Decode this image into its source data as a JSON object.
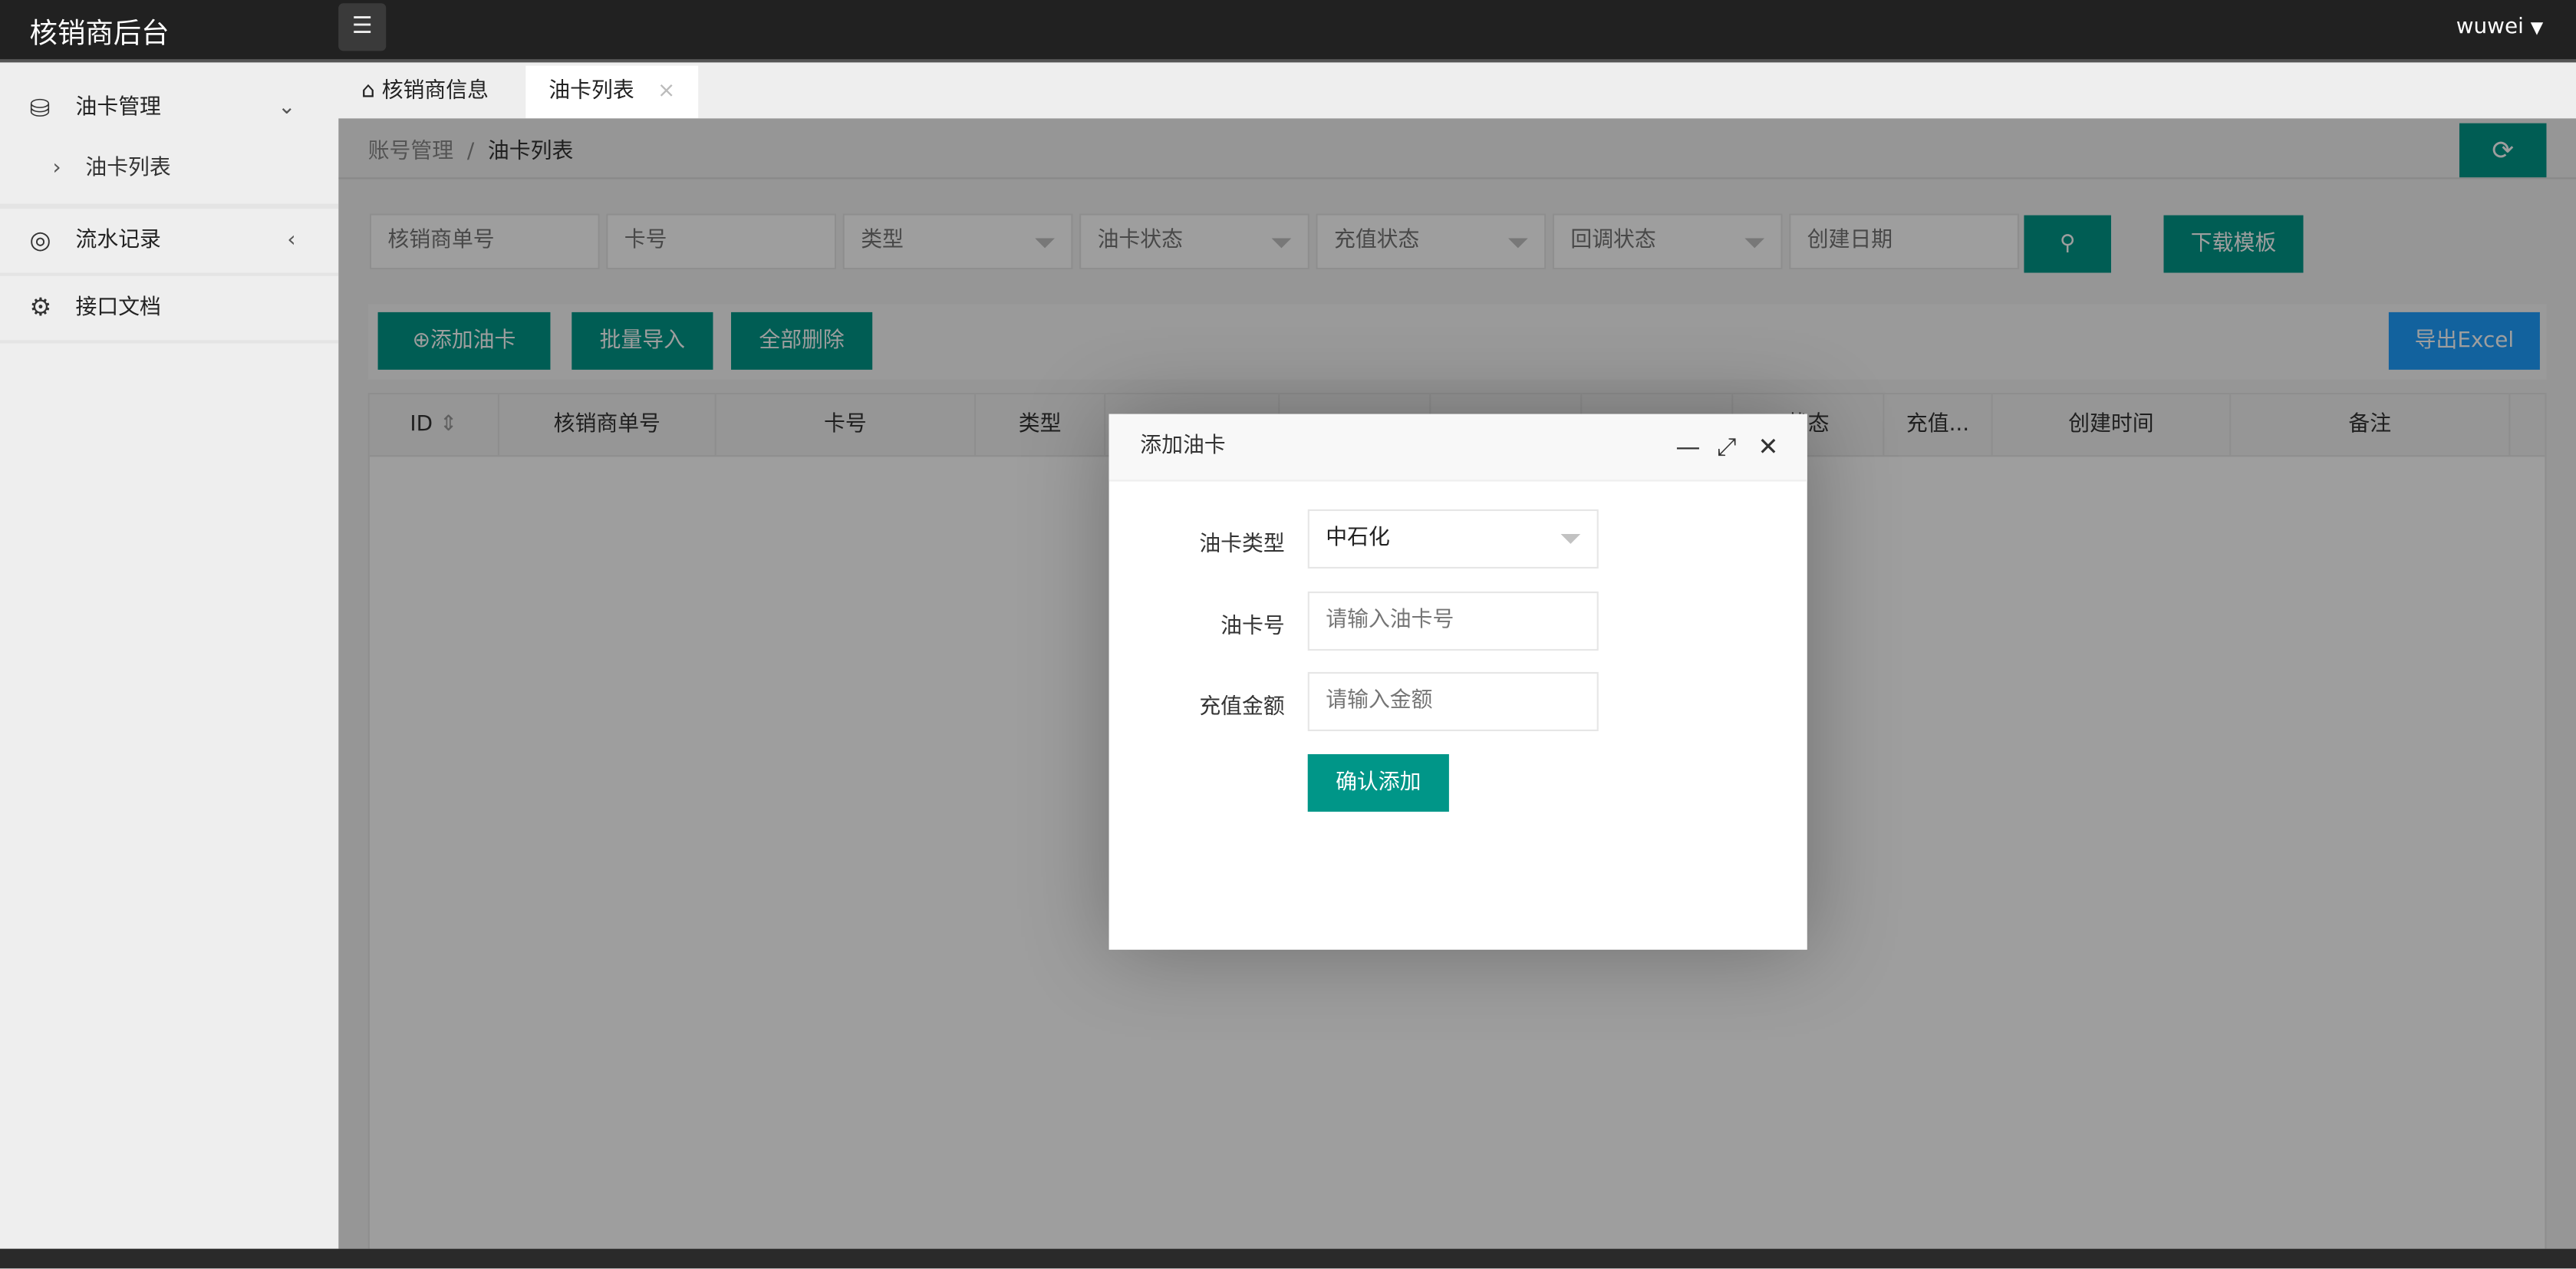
{
  "header": {
    "brand": "核销商后台",
    "menu_icon": "list-icon",
    "user": "wuwei"
  },
  "sidebar": {
    "items": [
      {
        "label": "油卡管理",
        "icon": "database-icon",
        "expanded": true,
        "children": [
          {
            "label": "油卡列表"
          }
        ]
      },
      {
        "label": "流水记录",
        "icon": "clock-icon"
      },
      {
        "label": "接口文档",
        "icon": "gear-icon"
      }
    ]
  },
  "tabs": [
    {
      "label": "核销商信息",
      "icon": "home-icon"
    },
    {
      "label": "油卡列表",
      "active": true
    }
  ],
  "breadcrumb": [
    "账号管理",
    "油卡列表"
  ],
  "filters": {
    "merchant_no": "核销商单号",
    "card_no": "卡号",
    "type": "类型",
    "card_status": "油卡状态",
    "recharge_status": "充值状态",
    "callback_status": "回调状态",
    "created_date": "创建日期"
  },
  "buttons": {
    "download_template": "下载模板",
    "add_card": "添加油卡",
    "batch_import": "批量导入",
    "delete_all": "全部删除",
    "export_excel": "导出Excel"
  },
  "table": {
    "columns": [
      "ID",
      "核销商单号",
      "卡号",
      "类型",
      "",
      "",
      "",
      "",
      "状态",
      "充值...",
      "创建时间",
      "备注"
    ]
  },
  "modal": {
    "title": "添加油卡",
    "card_type_label": "油卡类型",
    "card_type_value": "中石化",
    "card_no_label": "油卡号",
    "card_no_placeholder": "请输入油卡号",
    "amount_label": "充值金额",
    "amount_placeholder": "请输入金额",
    "submit": "确认添加"
  },
  "colors": {
    "primary": "#009688",
    "export": "#1E9FFF",
    "header": "#212121"
  }
}
